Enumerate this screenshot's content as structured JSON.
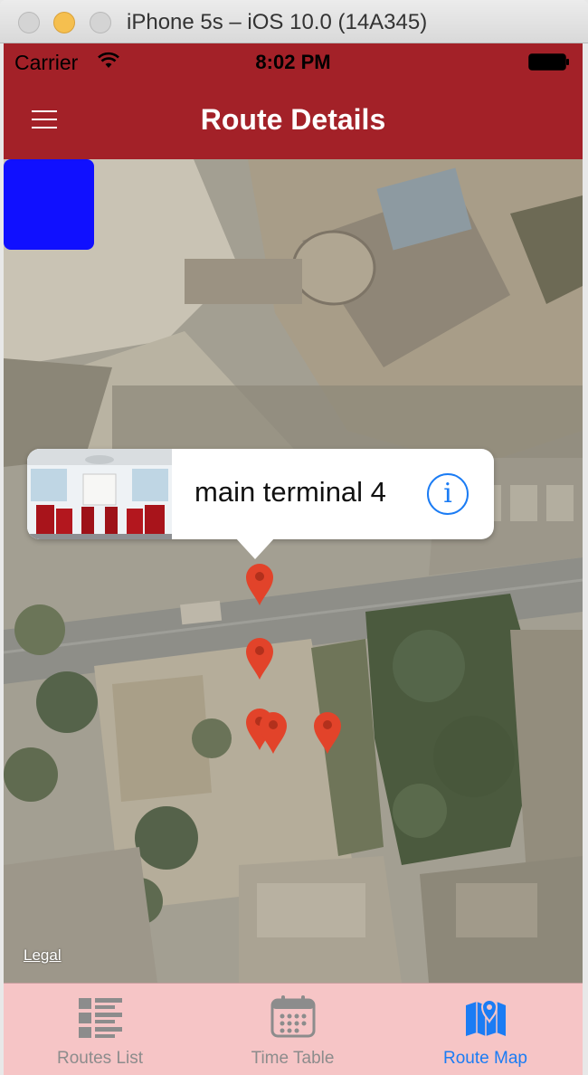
{
  "window": {
    "title": "iPhone 5s – iOS 10.0 (14A345)"
  },
  "status_bar": {
    "carrier": "Carrier",
    "time": "8:02 PM"
  },
  "nav_bar": {
    "title": "Route Details",
    "menu_icon": "hamburger-menu-icon"
  },
  "map": {
    "type": "satellite",
    "legal_label": "Legal",
    "callout": {
      "title": "main terminal 4",
      "info_icon": "info-icon"
    },
    "pin_color": "#e2432a"
  },
  "tab_bar": {
    "items": [
      {
        "label": "Routes List",
        "icon": "list-icon",
        "selected": false
      },
      {
        "label": "Time Table",
        "icon": "calendar-icon",
        "selected": false
      },
      {
        "label": "Route Map",
        "icon": "map-pin-icon",
        "selected": true
      }
    ],
    "active_color": "#1b7cf4",
    "inactive_color": "#8c8c8c"
  },
  "colors": {
    "bar_red": "#a32128",
    "tab_bar_bg": "#f6c5c6",
    "overlay_square": "#1010ff"
  }
}
